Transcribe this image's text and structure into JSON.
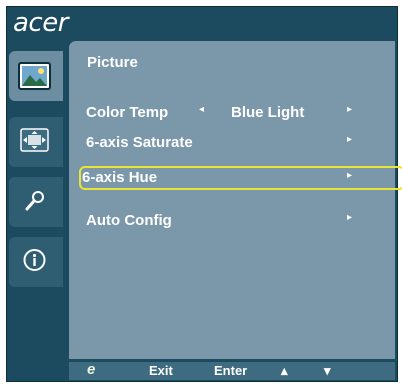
{
  "brand": "acer",
  "panel": {
    "title": "Picture"
  },
  "menu": [
    {
      "label": "Color Temp",
      "value": "Blue Light",
      "left_arrow": "◂",
      "right_arrow": "▸"
    },
    {
      "label": "6-axis Saturate",
      "right_arrow": "▸"
    },
    {
      "label": "6-axis Hue",
      "right_arrow": "▸",
      "selected": true
    },
    {
      "label": "Auto Config",
      "right_arrow": "▸"
    }
  ],
  "side_tabs": [
    {
      "icon": "picture-icon",
      "active": true
    },
    {
      "icon": "screen-position-icon",
      "active": false
    },
    {
      "icon": "settings-wrench-icon",
      "active": false
    },
    {
      "icon": "info-icon",
      "active": false
    }
  ],
  "footer": {
    "exit_icon": "e-key-icon",
    "exit_icon_glyph": "e",
    "exit_label": "Exit",
    "enter_label": "Enter",
    "up_glyph": "▴",
    "down_glyph": "▾"
  },
  "colors": {
    "frame": "#1c4a5e",
    "panel": "#7b98aa",
    "selection_outline": "#e9e437",
    "active_tab": "#6d8ea0"
  }
}
